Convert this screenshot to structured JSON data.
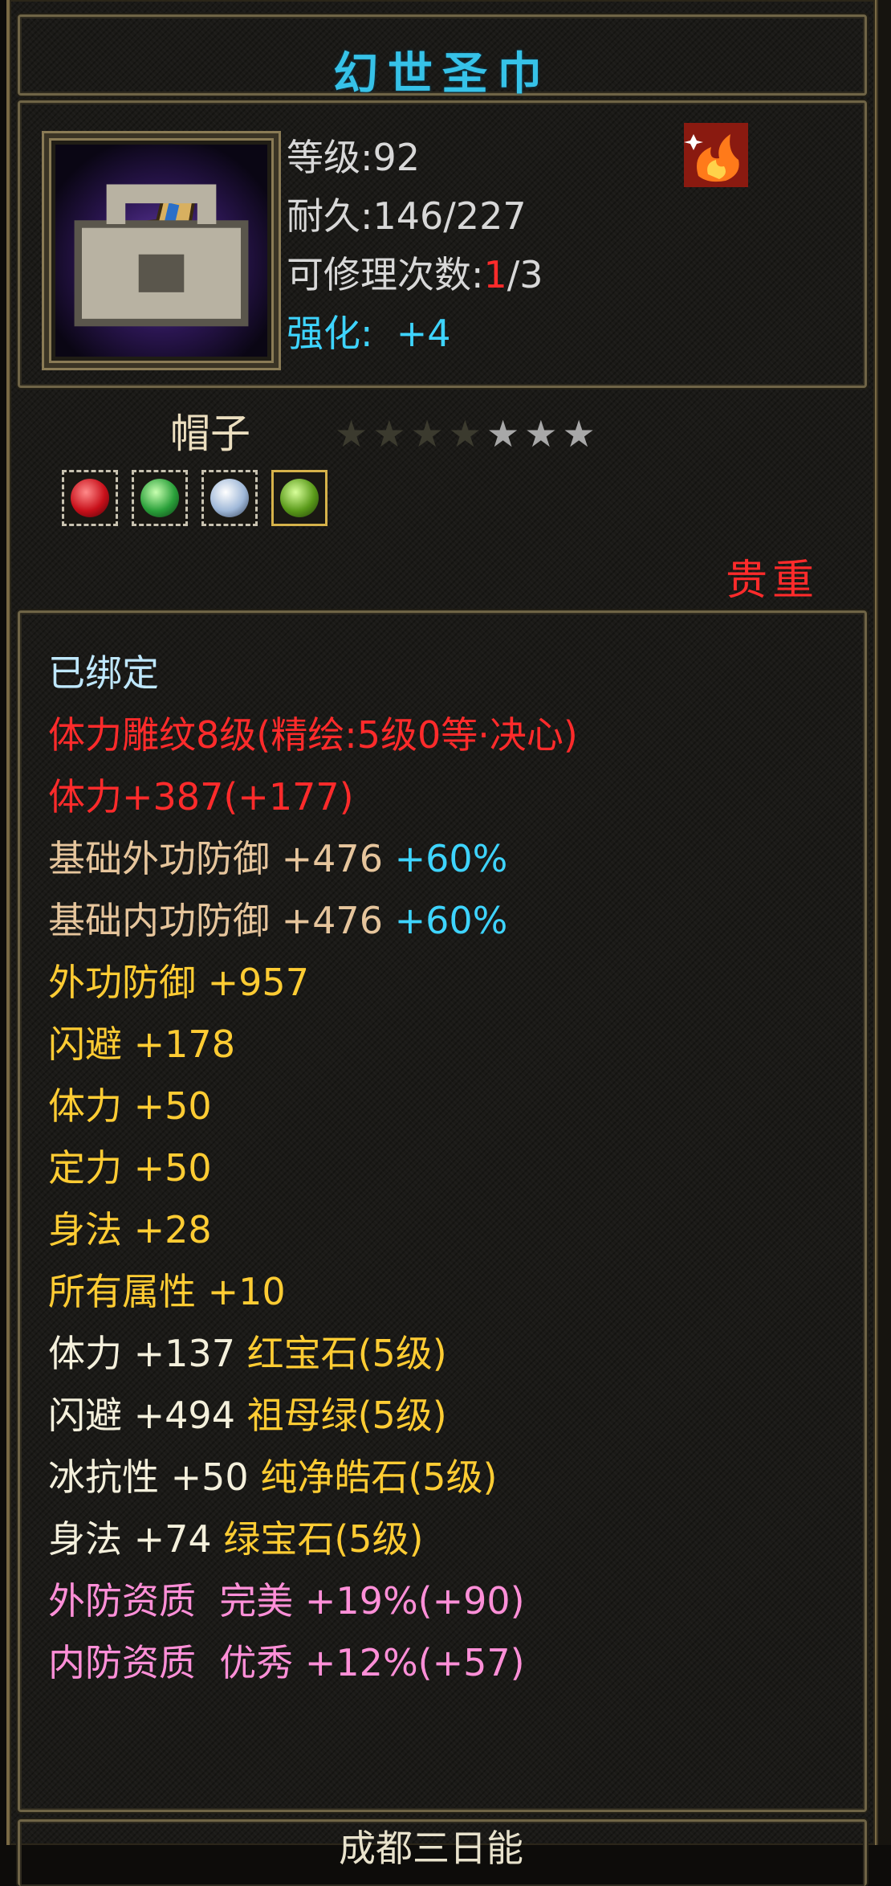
{
  "item": {
    "name": "幻世圣巾",
    "type": "帽子",
    "rarity": "贵重"
  },
  "info": {
    "level_label": "等级:",
    "level_value": "92",
    "durability_label": "耐久:",
    "durability_value": "146/227",
    "repair_label": "可修理次数:",
    "repair_used": "1",
    "repair_total": "/3",
    "strengthen_label": "强化:",
    "strengthen_value": "+4"
  },
  "stars": {
    "total": 7,
    "lit": 3
  },
  "gem_slots": [
    "ruby-gem-icon",
    "emerald-gem-icon",
    "diamond-gem-icon",
    "green-jade-gem-icon"
  ],
  "properties": {
    "bound": "已绑定",
    "engrave": "体力雕纹8级(精绘:5级0等·决心)",
    "stamina_total": "体力+387(+177)",
    "base_ext_def_label": "基础外功防御 +476",
    "base_ext_def_pct": "+60%",
    "base_int_def_label": "基础内功防御 +476",
    "base_int_def_pct": "+60%",
    "ext_def": "外功防御 +957",
    "dodge": "闪避 +178",
    "stamina": "体力 +50",
    "focus": "定力 +50",
    "agility": "身法 +28",
    "all_attr": "所有属性 +10",
    "gem1_stat": "体力 +137",
    "gem1_name": "红宝石(5级)",
    "gem2_stat": "闪避 +494",
    "gem2_name": "祖母绿(5级)",
    "gem3_stat": "冰抗性 +50",
    "gem3_name": "纯净皓石(5级)",
    "gem4_stat": "身法 +74",
    "gem4_name": "绿宝石(5级)",
    "quality_ext": "外防资质  完美 +19%(+90)",
    "quality_int": "内防资质  优秀 +12%(+57)"
  },
  "footer": {
    "text": "成都三日能"
  },
  "colors": {
    "title": "#36c2e8",
    "rarity": "#ff2b2b",
    "engrave": "#ff2b2b",
    "base_def": "#e6c59c",
    "bonus": "#ffcc33",
    "percent": "#3ed4ff",
    "quality": "#ff8fd8"
  }
}
